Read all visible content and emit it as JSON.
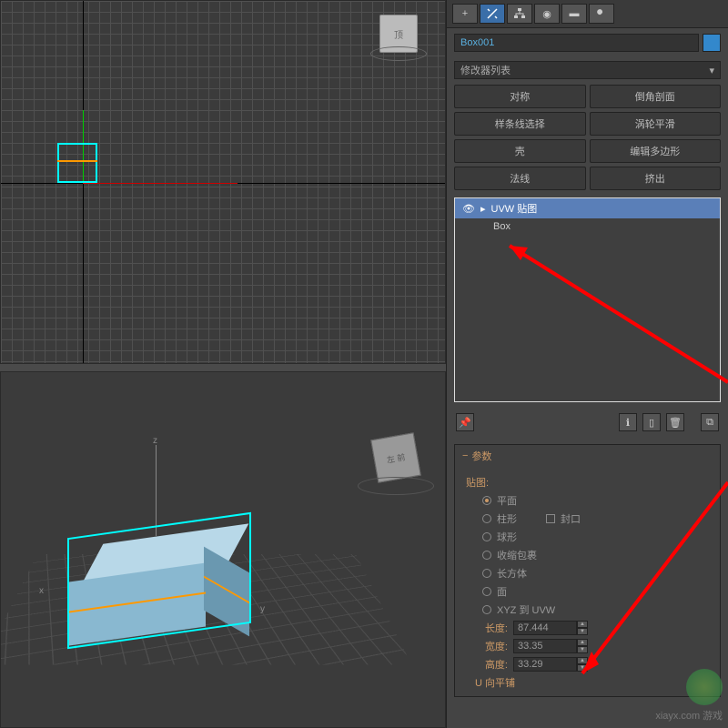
{
  "object_name": "Box001",
  "modifier_list_label": "修改器列表",
  "buttons": {
    "symmetry": "对称",
    "chamfer": "倒角剖面",
    "spline_sel": "样条线选择",
    "turbosmooth": "涡轮平滑",
    "shell": "壳",
    "edit_poly": "编辑多边形",
    "normal": "法线",
    "extrude": "挤出"
  },
  "stack": {
    "active": "UVW 贴图",
    "base": "Box"
  },
  "rollout": {
    "title": "参数",
    "mapping_label": "贴图:",
    "types": {
      "planar": "平面",
      "cylindrical": "柱形",
      "cap": "封口",
      "spherical": "球形",
      "shrink": "收缩包裹",
      "box": "长方体",
      "face": "面",
      "xyz": "XYZ 到 UVW"
    },
    "length_label": "长度:",
    "length_val": "87.444",
    "width_label": "宽度:",
    "width_val": "33.35",
    "height_label": "高度:",
    "height_val": "33.29",
    "tile_label": "U 向平铺"
  },
  "viewcube": {
    "top": "顶",
    "persp": "左 前"
  },
  "axes": {
    "x": "x",
    "y": "y",
    "z": "z"
  },
  "watermark": {
    "site": "xiayx.com",
    "brand": "游戏"
  }
}
